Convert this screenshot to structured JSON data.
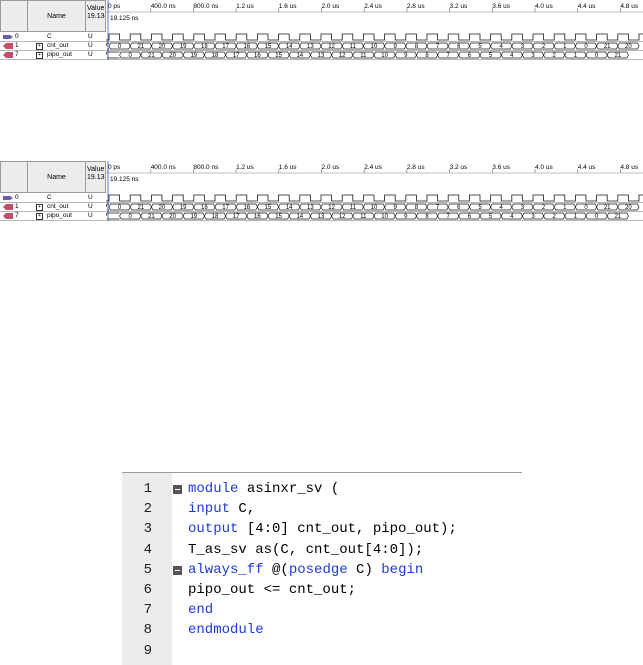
{
  "waveforms": [
    {
      "id": "wave1",
      "header": {
        "name_label": "Name",
        "value_label": "Value",
        "value_sub": "19.13"
      },
      "time_ticks": [
        "0 ps",
        "400.0 ns",
        "800.0 ns",
        "1.2 us",
        "1.6 us",
        "2.0 us",
        "2.4 us",
        "2.8 us",
        "3.2 us",
        "3.6 us",
        "4.0 us",
        "4.4 us",
        "4.8 us"
      ],
      "cursor_label": "19.125 ns",
      "signals": [
        {
          "index": "0",
          "name": "C",
          "value": "U",
          "kind": "clock"
        },
        {
          "index": "1",
          "name": "cnt_out",
          "value": "U",
          "kind": "bus",
          "segments": [
            "0",
            "21",
            "20",
            "19",
            "18",
            "17",
            "16",
            "15",
            "14",
            "13",
            "12",
            "11",
            "10",
            "9",
            "8",
            "7",
            "6",
            "5",
            "4",
            "3",
            "2",
            "1",
            "0",
            "21",
            "20"
          ]
        },
        {
          "index": "7",
          "name": "pipo_out",
          "value": "U",
          "kind": "bus",
          "segments": [
            "0",
            "21",
            "20",
            "19",
            "18",
            "17",
            "16",
            "15",
            "14",
            "13",
            "12",
            "11",
            "10",
            "9",
            "8",
            "7",
            "6",
            "5",
            "4",
            "3",
            "2",
            "1",
            "0",
            "21"
          ]
        }
      ]
    },
    {
      "id": "wave2",
      "header": {
        "name_label": "Name",
        "value_label": "Value",
        "value_sub": "19.13"
      },
      "time_ticks": [
        "0 ps",
        "400.0 ns",
        "800.0 ns",
        "1.2 us",
        "1.6 us",
        "2.0 us",
        "2.4 us",
        "2.8 us",
        "3.2 us",
        "3.6 us",
        "4.0 us",
        "4.4 us",
        "4.8 us"
      ],
      "cursor_label": "19.125 ns",
      "signals": [
        {
          "index": "0",
          "name": "C",
          "value": "U",
          "kind": "clock"
        },
        {
          "index": "1",
          "name": "cnt_out",
          "value": "U",
          "kind": "bus",
          "segments": [
            "0",
            "21",
            "20",
            "19",
            "18",
            "17",
            "16",
            "15",
            "14",
            "13",
            "12",
            "11",
            "10",
            "9",
            "8",
            "7",
            "6",
            "5",
            "4",
            "3",
            "2",
            "1",
            "0",
            "21",
            "20"
          ]
        },
        {
          "index": "7",
          "name": "pipo_out",
          "value": "U",
          "kind": "bus",
          "segments": [
            "0",
            "21",
            "20",
            "19",
            "18",
            "17",
            "16",
            "15",
            "14",
            "13",
            "12",
            "11",
            "10",
            "9",
            "8",
            "7",
            "6",
            "5",
            "4",
            "3",
            "2",
            "1",
            "0",
            "21"
          ]
        }
      ]
    }
  ],
  "code": {
    "lines": [
      {
        "num": "1",
        "fold": true,
        "parts": [
          [
            "kw",
            "module"
          ],
          [
            "",
            " asinxr_sv ("
          ]
        ]
      },
      {
        "num": "2",
        "fold": false,
        "parts": [
          [
            "kw",
            "input"
          ],
          [
            "",
            " C,"
          ]
        ]
      },
      {
        "num": "3",
        "fold": false,
        "parts": [
          [
            "kw",
            "output"
          ],
          [
            "",
            " [4:0] cnt_out, pipo_out);"
          ]
        ]
      },
      {
        "num": "4",
        "fold": false,
        "parts": [
          [
            "",
            "T_as_sv as(C, cnt_out[4:0]);"
          ]
        ]
      },
      {
        "num": "5",
        "fold": true,
        "parts": [
          [
            "kw",
            "always_ff"
          ],
          [
            "",
            " @("
          ],
          [
            "kw",
            "posedge"
          ],
          [
            "",
            " C) "
          ],
          [
            "kw",
            "begin"
          ]
        ]
      },
      {
        "num": "6",
        "fold": false,
        "parts": [
          [
            "",
            "pipo_out <= cnt_out;"
          ]
        ]
      },
      {
        "num": "7",
        "fold": false,
        "parts": [
          [
            "kw",
            "end"
          ]
        ]
      },
      {
        "num": "8",
        "fold": false,
        "parts": [
          [
            "kw",
            "endmodule"
          ]
        ]
      },
      {
        "num": "9",
        "fold": false,
        "parts": []
      }
    ]
  },
  "colors": {
    "keyword": "#1f3ad6",
    "wave_line": "#1a1a1a",
    "grid": "#7f7f7f",
    "pin_icon": "#6a5fa8"
  }
}
